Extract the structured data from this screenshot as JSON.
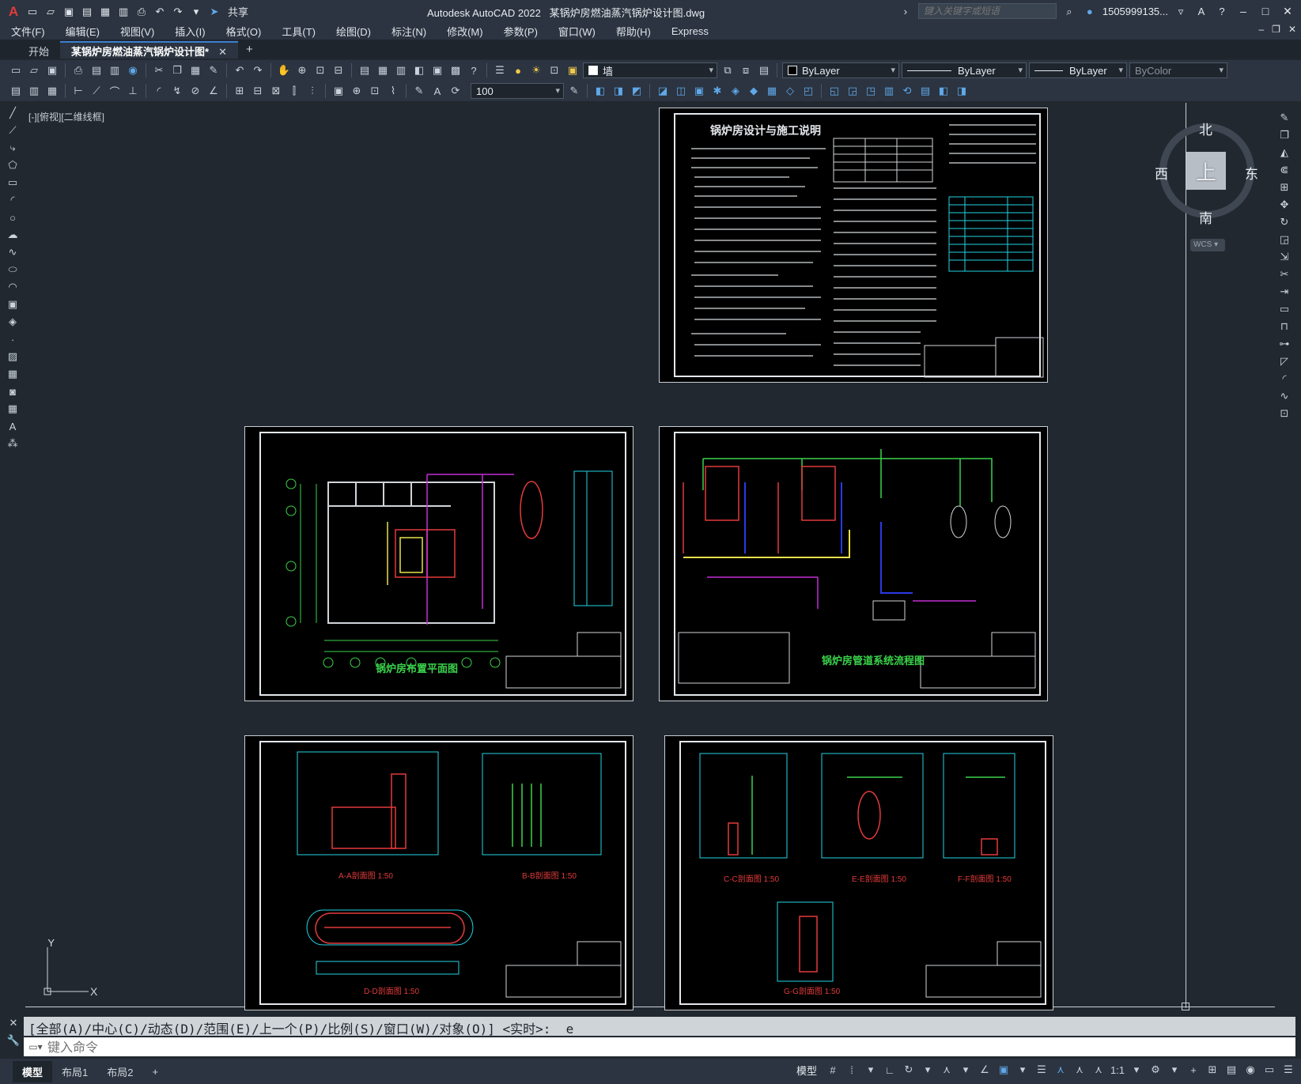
{
  "app": {
    "name": "Autodesk AutoCAD 2022",
    "file": "某锅炉房燃油蒸汽锅炉设计图.dwg",
    "share": "共享",
    "search_placeholder": "键入关键字或短语",
    "user": "1505999135...",
    "colors": {
      "titlebar": "#2b3440",
      "canvas": "#212830",
      "accent": "#3d7fd1"
    }
  },
  "menu": [
    "文件(F)",
    "编辑(E)",
    "视图(V)",
    "插入(I)",
    "格式(O)",
    "工具(T)",
    "绘图(D)",
    "标注(N)",
    "修改(M)",
    "参数(P)",
    "窗口(W)",
    "帮助(H)",
    "Express"
  ],
  "tabs": [
    {
      "label": "开始"
    },
    {
      "label": "某锅炉房燃油蒸汽锅炉设计图*"
    }
  ],
  "toolbar": {
    "layer": "墙",
    "color": "ByLayer",
    "linetype": "ByLayer",
    "lineweight": "ByLayer",
    "plotstyle": "ByColor",
    "scale": "100"
  },
  "viewport": {
    "label": "[-][俯视][二维线框]",
    "north": "北",
    "south": "南",
    "east": "东",
    "west": "西",
    "top": "上",
    "wcs": "WCS ▾",
    "ucs_x": "X",
    "ucs_y": "Y"
  },
  "sheets": {
    "s1": "锅炉房设计与施工说明",
    "s2": "锅炉房布置平面图",
    "s3": "锅炉房管道系统流程图",
    "s4a": "A-A剖面图 1:50",
    "s4b": "B-B剖面图 1:50",
    "s4c": "D-D剖面图 1:50",
    "s5a": "C-C剖面图 1:50",
    "s5b": "E-E剖面图 1:50",
    "s5c": "F-F剖面图 1:50",
    "s5d": "G-G剖面图 1:50"
  },
  "command": {
    "history": "[全部(A)/中心(C)/动态(D)/范围(E)/上一个(P)/比例(S)/窗口(W)/对象(O)] <实时>: _e",
    "placeholder": "键入命令"
  },
  "status": {
    "tabs": [
      "模型",
      "布局1",
      "布局2"
    ],
    "add": "+",
    "model": "模型",
    "scale": "1:1"
  }
}
